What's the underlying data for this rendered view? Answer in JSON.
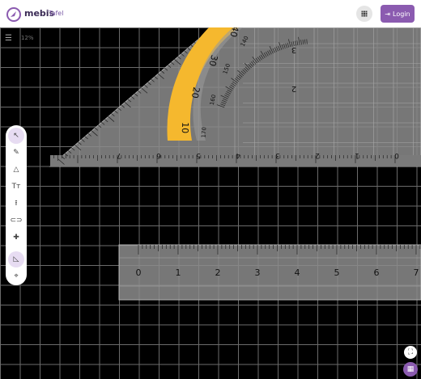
{
  "header": {
    "brand": "mebis",
    "product": "Tafel",
    "login_label": "Login",
    "brand_color": "#8b5bb0"
  },
  "board": {
    "zoom_label": "12%"
  },
  "toolbar": {
    "tools": [
      {
        "name": "select",
        "icon": "cursor-icon",
        "glyph": "↖",
        "active": true
      },
      {
        "name": "pen",
        "icon": "pen-icon",
        "glyph": "✎",
        "active": false
      },
      {
        "name": "shapes",
        "icon": "shapes-icon",
        "glyph": "△",
        "active": false
      },
      {
        "name": "text",
        "icon": "text-icon",
        "glyph": "Tт",
        "active": false
      },
      {
        "name": "upload",
        "icon": "upload-icon",
        "glyph": "⭱",
        "active": false
      },
      {
        "name": "link",
        "icon": "link-icon",
        "glyph": "⊂⊃",
        "active": false
      },
      {
        "name": "add",
        "icon": "add-icon",
        "glyph": "✚",
        "active": false
      },
      {
        "name": "geometry",
        "icon": "set-square-icon",
        "glyph": "◺",
        "active": true
      },
      {
        "name": "crosshair",
        "icon": "crosshair-icon",
        "glyph": "⌖",
        "active": false
      }
    ]
  },
  "ruler": {
    "labels": [
      "0",
      "1",
      "2",
      "3",
      "4",
      "5",
      "6",
      "7"
    ]
  },
  "set_square": {
    "edge_labels": [
      "7",
      "6",
      "5",
      "4",
      "3",
      "2",
      "1",
      "0"
    ],
    "scale_labels": [
      "3",
      "2"
    ],
    "protractor_outer": [
      "40",
      "30",
      "20",
      "10"
    ],
    "protractor_inner": [
      "140",
      "150",
      "160",
      "170"
    ],
    "protractor_color": "#f5b82e"
  }
}
